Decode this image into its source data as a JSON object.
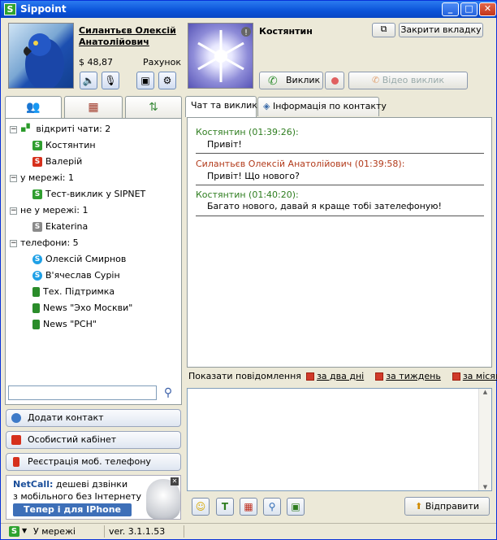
{
  "window": {
    "title": "Sippoint",
    "app_icon_letter": "S"
  },
  "titlebar_controls": {
    "minimize": "_",
    "maximize": "□",
    "close": "✕"
  },
  "me": {
    "name": "Силантьєв Олексій Анатолійович",
    "balance": "$ 48,87",
    "account_label": "Рахунок"
  },
  "contact": {
    "name": "Костянтин"
  },
  "buttons": {
    "close_tab": "Закрити вкладку",
    "call": "Виклик",
    "video_call": "Відео виклик",
    "add_contact": "Додати контакт",
    "personal_cabinet": "Особистий кабінет",
    "register_mobile": "Реєстрація моб. телефону",
    "send": "Відправити"
  },
  "left_tabs": [
    {
      "icon": "users-icon",
      "glyph": "👥"
    },
    {
      "icon": "keypad-icon",
      "glyph": "▦"
    },
    {
      "icon": "sort-icon",
      "glyph": "⇅"
    }
  ],
  "contact_groups": [
    {
      "label": "відкриті чати: 2",
      "items": [
        {
          "name": "Костянтин",
          "type": "green",
          "glyph": "S"
        },
        {
          "name": "Валерій",
          "type": "red",
          "glyph": "S"
        }
      ]
    },
    {
      "label": "у мережі: 1",
      "items": [
        {
          "name": "Тест-виклик у SIPNET",
          "type": "green",
          "glyph": "S"
        }
      ]
    },
    {
      "label": "не у мережі: 1",
      "items": [
        {
          "name": "Ekaterina",
          "type": "gray",
          "glyph": "S"
        }
      ]
    },
    {
      "label": "телефони: 5",
      "items": [
        {
          "name": "Олексій Смирнов",
          "type": "skype",
          "glyph": "S"
        },
        {
          "name": "В'ячеслав Сурін",
          "type": "skype",
          "glyph": "S"
        },
        {
          "name": "Тех. Підтримка",
          "type": "phone",
          "glyph": ""
        },
        {
          "name": "News \"Эхо Москви\"",
          "type": "phone",
          "glyph": ""
        },
        {
          "name": "News \"РСН\"",
          "type": "phone",
          "glyph": ""
        }
      ]
    }
  ],
  "search": {
    "value": ""
  },
  "ad": {
    "brand": "NetCall:",
    "line1_rest": "дешеві дзвінки",
    "line2": "з мобільного без Інтернету",
    "line3": "Тепер і для IPhone"
  },
  "chat_tabs": {
    "chat": "Чат та виклики",
    "info": "Інформація по контакту"
  },
  "messages": [
    {
      "header": "Костянтин (01:39:26):",
      "text": "Привіт!",
      "color": "#2e7d1f"
    },
    {
      "header": "Силантьєв Олексій Анатолійович (01:39:58):",
      "text": "Привіт! Що нового?",
      "color": "#b23a1a"
    },
    {
      "header": "Костянтин (01:40:20):",
      "text": "Багато нового, давай я краще тобі зателефоную!",
      "color": "#2e7d1f"
    }
  ],
  "history_filter": {
    "label": "Показати повідомлення",
    "two_days": "за два дні",
    "week": "за тиждень",
    "month": "за місяць"
  },
  "status": {
    "state": "У мережі",
    "version": "ver. 3.1.1.53"
  }
}
